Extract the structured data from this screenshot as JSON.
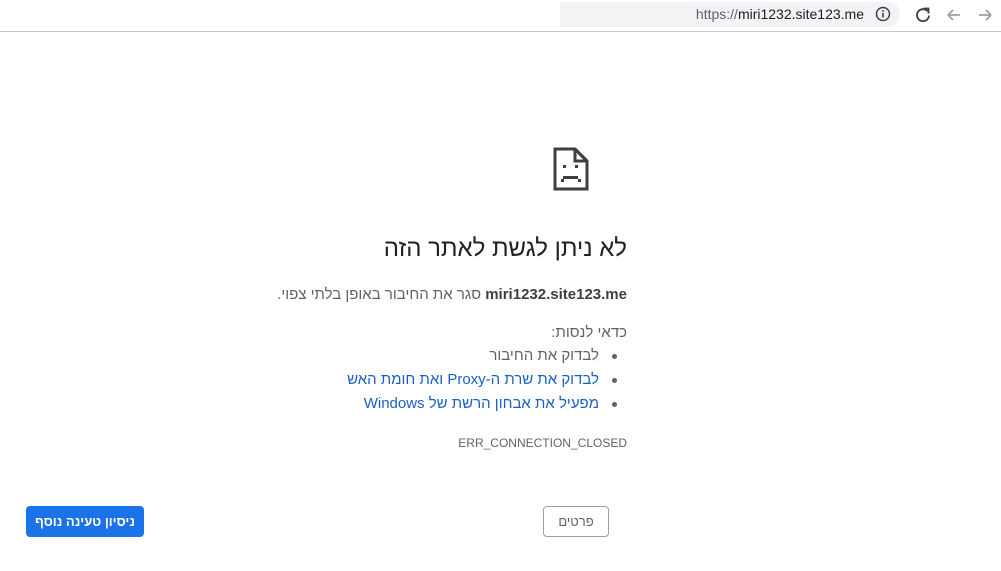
{
  "browser": {
    "url_scheme": "https://",
    "url_host": "miri1232.site123.me",
    "icons": {
      "site_info": "info-icon",
      "reload": "reload-icon",
      "back": "back-arrow-icon",
      "forward": "forward-arrow-icon"
    }
  },
  "error_page": {
    "icon": "sad-page-icon",
    "headline": "לא ניתן לגשת לאתר הזה",
    "subtext_host": "miri1232.site123.me",
    "subtext_rest": "סגר את החיבור באופן בלתי צפוי.",
    "try_title": "כדאי לנסות:",
    "suggestions": [
      {
        "label": "לבדוק את החיבור",
        "is_link": false
      },
      {
        "label": "לבדוק את שרת ה-Proxy ואת חומת האש",
        "is_link": true
      },
      {
        "label": "מפעיל את אבחון הרשת של Windows",
        "is_link": true
      }
    ],
    "error_code": "ERR_CONNECTION_CLOSED",
    "reload_button": "ניסיון טעינה נוסף",
    "details_button": "פרטים"
  },
  "colors": {
    "primary_button": "#1a73e8",
    "link": "#1a5fc4",
    "text_primary": "#202124",
    "text_secondary": "#5f6368"
  }
}
